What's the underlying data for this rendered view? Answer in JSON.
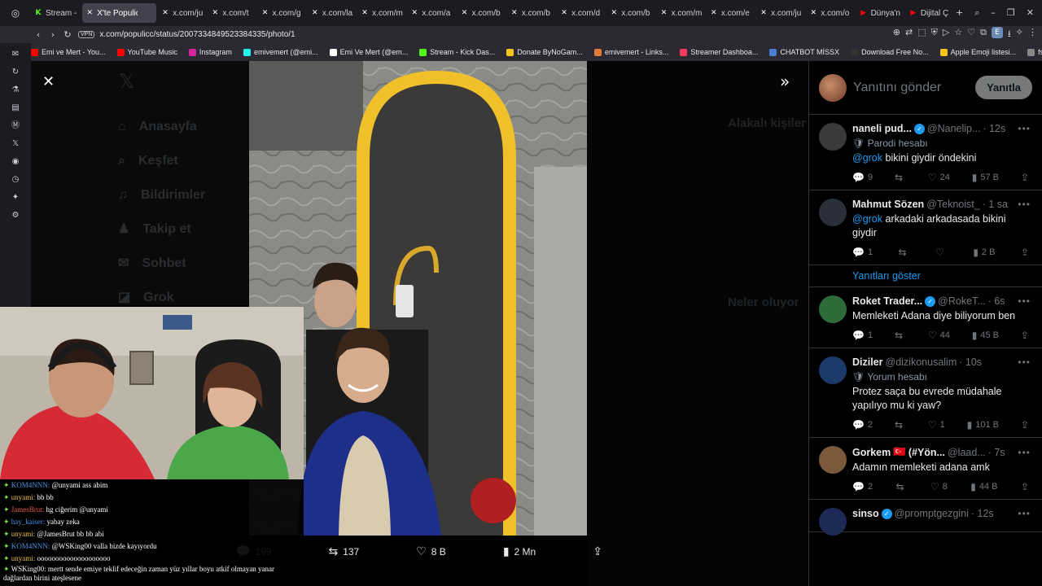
{
  "browser": {
    "tabs": [
      {
        "label": "Stream -",
        "icon": "kick-icon",
        "color": "#53fc18"
      },
      {
        "label": "X'te Populicc: \"",
        "icon": "x-icon",
        "color": "#ffffff",
        "active": true
      },
      {
        "label": "x.com/ju",
        "icon": "x-icon",
        "color": "#ffffff"
      },
      {
        "label": "x.com/t",
        "icon": "x-icon",
        "color": "#ffffff"
      },
      {
        "label": "x.com/g",
        "icon": "x-icon",
        "color": "#ffffff"
      },
      {
        "label": "x.com/la",
        "icon": "x-icon",
        "color": "#ffffff"
      },
      {
        "label": "x.com/m",
        "icon": "x-icon",
        "color": "#ffffff"
      },
      {
        "label": "x.com/a",
        "icon": "x-icon",
        "color": "#ffffff"
      },
      {
        "label": "x.com/b",
        "icon": "x-icon",
        "color": "#ffffff"
      },
      {
        "label": "x.com/b",
        "icon": "x-icon",
        "color": "#ffffff"
      },
      {
        "label": "x.com/d",
        "icon": "x-icon",
        "color": "#ffffff"
      },
      {
        "label": "x.com/b",
        "icon": "x-icon",
        "color": "#ffffff"
      },
      {
        "label": "x.com/m",
        "icon": "x-icon",
        "color": "#ffffff"
      },
      {
        "label": "x.com/e",
        "icon": "x-icon",
        "color": "#ffffff"
      },
      {
        "label": "x.com/ju",
        "icon": "x-icon",
        "color": "#ffffff"
      },
      {
        "label": "x.com/o",
        "icon": "x-icon",
        "color": "#ffffff"
      },
      {
        "label": "Dünya'n",
        "icon": "youtube-icon",
        "color": "#ff0000"
      },
      {
        "label": "Dijital Ç",
        "icon": "youtube-icon",
        "color": "#ff0000"
      }
    ],
    "url": "x.com/populicc/status/2007334849523384335/photo/1",
    "vpn_label": "VPN",
    "bookmarks": [
      {
        "label": "Emi ve Mert - You...",
        "color": "#ff0000"
      },
      {
        "label": "YouTube Music",
        "color": "#ff0000"
      },
      {
        "label": "Instagram",
        "color": "#d6249f"
      },
      {
        "label": "emivemert (@emi...",
        "color": "#25f4ee"
      },
      {
        "label": "Emi Ve Mert (@em...",
        "color": "#ffffff"
      },
      {
        "label": "Stream - Kick Das...",
        "color": "#53fc18"
      },
      {
        "label": "Donate ByNoGam...",
        "color": "#f5c518"
      },
      {
        "label": "emivemert - Links...",
        "color": "#e07b39"
      },
      {
        "label": "Streamer Dashboa...",
        "color": "#ff3a5c"
      },
      {
        "label": "CHATBOT MİSSX",
        "color": "#4a7bd6"
      },
      {
        "label": "Download Free No...",
        "color": "#333333"
      },
      {
        "label": "Apple Emoji listesi...",
        "color": "#f5c518"
      },
      {
        "label": "fsfsd",
        "color": "#888888"
      }
    ]
  },
  "x_bg": {
    "nav": [
      "Anasayfa",
      "Keşfet",
      "Bildirimler",
      "Takip et",
      "Sohbet",
      "Grok"
    ],
    "right": [
      "Alakalı kişiler",
      "Neler oluyor"
    ]
  },
  "photo_actions": {
    "replies": "199",
    "reposts": "137",
    "likes": "8 B",
    "views": "2 Mn"
  },
  "reply_box": {
    "placeholder": "Yanıtını gönder",
    "button": "Yanıtla"
  },
  "tweets": [
    {
      "name": "naneli pud...",
      "verified": true,
      "handle": "@Nanelip...",
      "time": "· 12s",
      "label": "Parodi hesabı",
      "mention": "@grok",
      "text": " bikini giydir öndekini",
      "replies": "9",
      "reposts": "",
      "likes": "24",
      "views": "57 B",
      "avatar": "#3a3a3a"
    },
    {
      "name": "Mahmut Sözen",
      "verified": false,
      "handle": "@Teknoist_",
      "time": "· 1 sa",
      "label": "",
      "mention": "@grok",
      "text": " arkadaki arkadasada bikini giydir",
      "replies": "1",
      "reposts": "",
      "likes": "",
      "views": "2 B",
      "avatar": "#2a2f3a"
    },
    {
      "name": "Roket Trader...",
      "verified": true,
      "handle": "@RokeT...",
      "time": "· 6s",
      "label": "",
      "mention": "",
      "text": "Memleketi Adana diye biliyorum ben",
      "replies": "1",
      "reposts": "",
      "likes": "44",
      "views": "45 B",
      "avatar": "#2e6b3a"
    },
    {
      "name": "Diziler",
      "verified": false,
      "handle": "@dizikonusalim",
      "time": "· 10s",
      "label": "Yorum hesabı",
      "mention": "",
      "text": "Protez saça bu evrede müdahale yapılıyo mu ki yaw?",
      "replies": "2",
      "reposts": "",
      "likes": "1",
      "views": "101 B",
      "avatar": "#1a3a6b"
    },
    {
      "name": "Gorkem",
      "verified": false,
      "flag": "🇹🇷",
      "namesuffix": "(#Yön...",
      "handle": "@laad...",
      "time": "· 7s",
      "label": "",
      "mention": "",
      "text": "Adamın memleketi adana amk",
      "replies": "2",
      "reposts": "",
      "likes": "8",
      "views": "44 B",
      "avatar": "#7a5a3a"
    },
    {
      "name": "sinso",
      "verified": true,
      "handle": "@promptgezgini",
      "time": "· 12s",
      "label": "",
      "mention": "",
      "text": "",
      "replies": "",
      "reposts": "",
      "likes": "",
      "views": "",
      "avatar": "#1c2a55"
    }
  ],
  "show_replies": "Yanıtları göster",
  "chat": [
    {
      "user": "KOM4NNN:",
      "color": "#4a90e2",
      "msg": " @unyami ass abim"
    },
    {
      "user": "unyami:",
      "color": "#e8b84a",
      "msg": " bb bb"
    },
    {
      "user": "JamesBrut:",
      "color": "#e05a4a",
      "msg": " hg ciğerim @unyami"
    },
    {
      "user": "hay_kaiser:",
      "color": "#4a90e2",
      "msg": " yabay zeka"
    },
    {
      "user": "unyami:",
      "color": "#e8b84a",
      "msg": " @JamesBrut bb bb abi"
    },
    {
      "user": "KOM4NNN:",
      "color": "#4a90e2",
      "msg": " @WSKing00 valla bizde kayıyordu"
    },
    {
      "user": "unyami:",
      "color": "#e8b84a",
      "msg": " oooooooooooooooooooo"
    }
  ],
  "chat_tail": {
    "user": "WSKing00:",
    "line1": " mertt sende emiye teklif edeceğin zaman yüz yıllar boyu atkif olmayan yanar",
    "line2": "dağlardan birini ateşlesene"
  }
}
